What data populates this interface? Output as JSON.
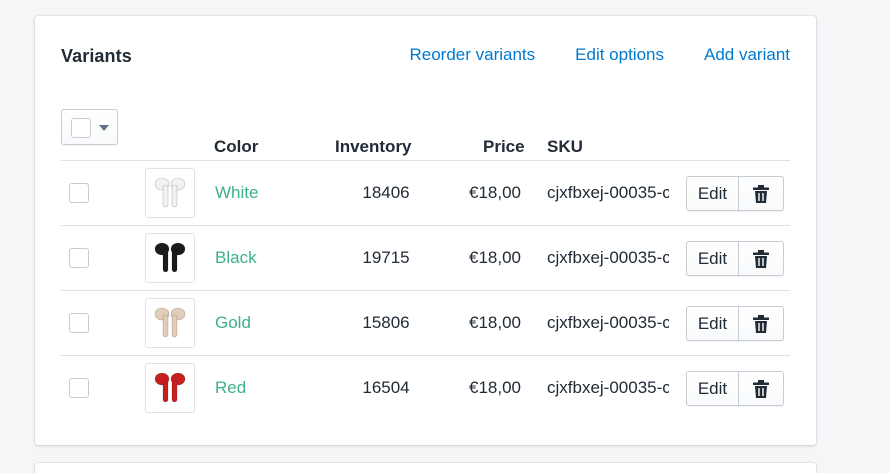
{
  "card": {
    "title": "Variants",
    "actions": {
      "reorder": "Reorder variants",
      "edit_options": "Edit options",
      "add_variant": "Add variant"
    }
  },
  "table": {
    "headers": {
      "color": "Color",
      "inventory": "Inventory",
      "price": "Price",
      "sku": "SKU"
    },
    "edit_label": "Edit",
    "rows": [
      {
        "color": "White",
        "inventory": "18406",
        "price": "€18,00",
        "sku": "cjxfbxej-00035-c",
        "swatch": "#f1f2f3"
      },
      {
        "color": "Black",
        "inventory": "19715",
        "price": "€18,00",
        "sku": "cjxfbxej-00035-c",
        "swatch": "#1b1b1b"
      },
      {
        "color": "Gold",
        "inventory": "15806",
        "price": "€18,00",
        "sku": "cjxfbxej-00035-c",
        "swatch": "#e2cdb8"
      },
      {
        "color": "Red",
        "inventory": "16504",
        "price": "€18,00",
        "sku": "cjxfbxej-00035-c",
        "swatch": "#c8201e"
      }
    ]
  },
  "colors": {
    "link": "#007ace",
    "variant_link": "#3eb08c",
    "text": "#212b36",
    "border": "#dfe3e8"
  },
  "icons": {
    "row_checkbox": "checkbox-icon",
    "bulk_dropdown": "caret-down-icon",
    "delete": "trash-icon",
    "thumbnail": "earbuds-icon"
  }
}
